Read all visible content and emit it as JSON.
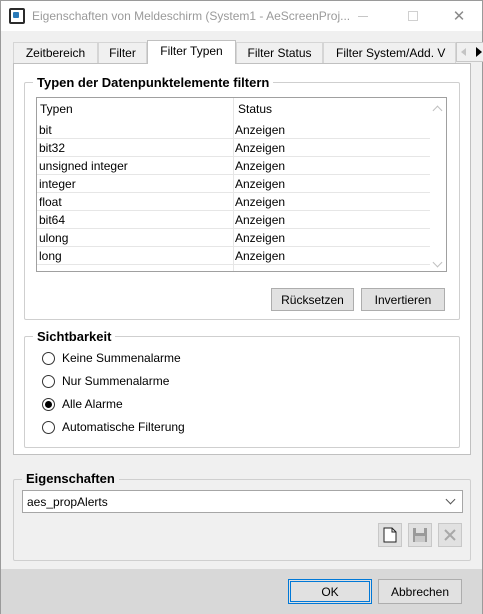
{
  "window": {
    "title": "Eigenschaften von Meldeschirm (System1 - AeScreenProj...",
    "icon": "aescreen-app-icon",
    "controls": [
      "minimize-icon",
      "maximize-icon",
      "close-icon"
    ]
  },
  "tabs": [
    {
      "label": "Zeitbereich",
      "active": false
    },
    {
      "label": "Filter",
      "active": false
    },
    {
      "label": "Filter Typen",
      "active": true
    },
    {
      "label": "Filter Status",
      "active": false
    },
    {
      "label": "Filter System/Add. V",
      "active": false
    }
  ],
  "types_group": {
    "title": "Typen der Datenpunktelemente filtern",
    "columns": [
      "Typen",
      "Status"
    ],
    "rows": [
      {
        "type": "bit",
        "status": "Anzeigen"
      },
      {
        "type": "bit32",
        "status": "Anzeigen"
      },
      {
        "type": "unsigned integer",
        "status": "Anzeigen"
      },
      {
        "type": "integer",
        "status": "Anzeigen"
      },
      {
        "type": "float",
        "status": "Anzeigen"
      },
      {
        "type": "bit64",
        "status": "Anzeigen"
      },
      {
        "type": "ulong",
        "status": "Anzeigen"
      },
      {
        "type": "long",
        "status": "Anzeigen"
      }
    ],
    "reset_label": "Rücksetzen",
    "invert_label": "Invertieren"
  },
  "visibility_group": {
    "title": "Sichtbarkeit",
    "options": [
      {
        "label": "Keine Summenalarme",
        "selected": false
      },
      {
        "label": "Nur Summenalarme",
        "selected": false
      },
      {
        "label": "Alle Alarme",
        "selected": true
      },
      {
        "label": "Automatische Filterung",
        "selected": false
      }
    ]
  },
  "properties_group": {
    "title": "Eigenschaften",
    "selected_value": "aes_propAlerts",
    "actions": [
      "new-file-icon",
      "save-icon",
      "delete-icon"
    ]
  },
  "footer": {
    "ok_label": "OK",
    "cancel_label": "Abbrechen"
  }
}
